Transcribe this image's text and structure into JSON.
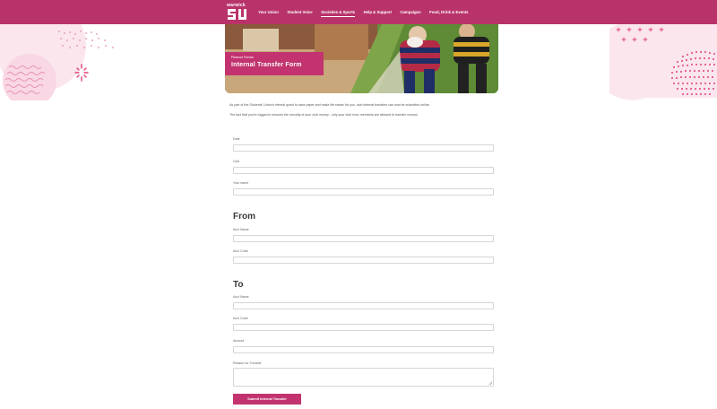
{
  "brand": {
    "wordmark": "warwick",
    "accent": "#b8336a"
  },
  "nav": {
    "items": [
      {
        "label": "Your Union"
      },
      {
        "label": "Student Voice"
      },
      {
        "label": "Societies & Sports"
      },
      {
        "label": "Help & Support"
      },
      {
        "label": "Campaigns"
      },
      {
        "label": "Food, Drink & Events"
      }
    ],
    "active": "Societies & Sports"
  },
  "hero": {
    "kicker": "Finance Forms",
    "title": "Internal Transfer Form"
  },
  "intro": {
    "line1": "As part of the Students' Union's eternal quest to save paper and make life easier for you, club internal transfers can now be submitted online.",
    "line2": "The fact that you're logged in ensures the security of your club money - only your club exec members are allowed to transfer money!"
  },
  "form": {
    "date_label": "Date",
    "club_label": "Club",
    "your_name_label": "Your name",
    "from_heading": "From",
    "from_acct_name_label": "Acct Name",
    "from_acct_code_label": "Acct Code",
    "to_heading": "To",
    "to_acct_name_label": "Acct Name",
    "to_acct_code_label": "Acct Code",
    "amount_label": "Amount",
    "reason_label": "Reason for Transfer",
    "submit_label": "Submit Internal Transfer"
  }
}
